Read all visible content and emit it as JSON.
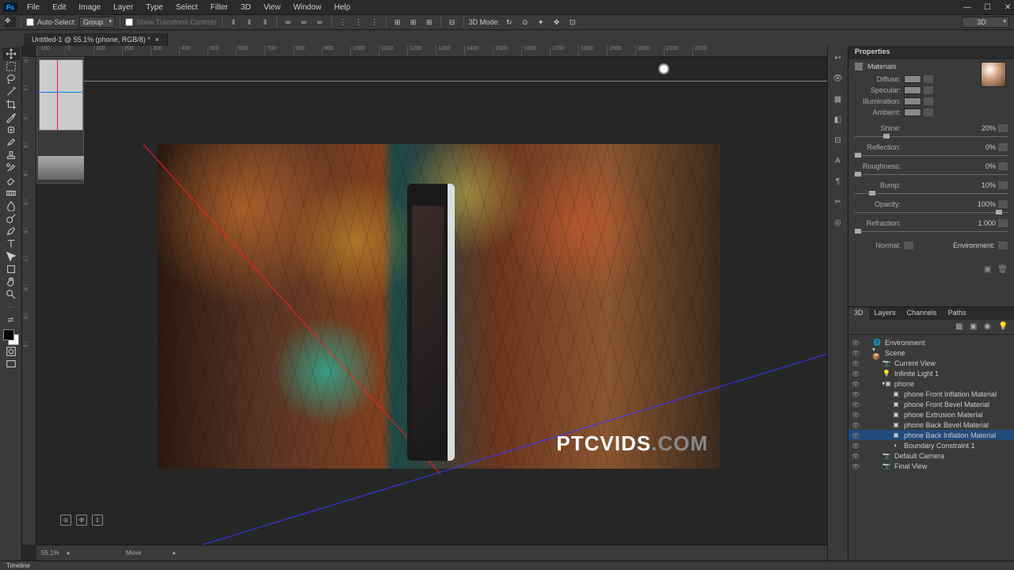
{
  "menu": {
    "items": [
      "File",
      "Edit",
      "Image",
      "Layer",
      "Type",
      "Select",
      "Filter",
      "3D",
      "View",
      "Window",
      "Help"
    ],
    "logo": "Ps"
  },
  "options": {
    "auto_select_label": "Auto-Select:",
    "group": "Group",
    "show_transform": "Show Transform Controls",
    "mode_label": "3D Mode:"
  },
  "tab": {
    "title": "Untitled-1 @ 55.1% (phone, RGB/8) *"
  },
  "ruler_marks": [
    "-100",
    "0",
    "100",
    "200",
    "300",
    "400",
    "500",
    "600",
    "700",
    "800",
    "900",
    "1000",
    "1100",
    "1200",
    "1300",
    "1400",
    "1500",
    "1600",
    "1700",
    "1800",
    "1900",
    "2000",
    "2100",
    "2200"
  ],
  "vruler_marks": [
    "0",
    "1",
    "2",
    "3",
    "4",
    "5",
    "6",
    "7",
    "8",
    "9",
    "1"
  ],
  "footer": {
    "zoom": "55.1%",
    "tool": "Move"
  },
  "timeline": {
    "label": "Timeline"
  },
  "watermark": {
    "a": "PTCVIDS",
    "b": ".COM"
  },
  "properties": {
    "title": "Properties",
    "subtitle": "Materials",
    "rows": [
      {
        "label": "Diffuse:",
        "swatch": true
      },
      {
        "label": "Specular:",
        "swatch": true
      },
      {
        "label": "Illumination:",
        "swatch": true
      },
      {
        "label": "Ambient:",
        "swatch": true
      }
    ],
    "sliders": [
      {
        "label": "Shine:",
        "value": "20%",
        "pos": 20
      },
      {
        "label": "Reflection:",
        "value": "0%",
        "pos": 0
      },
      {
        "label": "Roughness:",
        "value": "0%",
        "pos": 0
      },
      {
        "label": "Bump:",
        "value": "10%",
        "pos": 10
      },
      {
        "label": "Opacity:",
        "value": "100%",
        "pos": 100
      },
      {
        "label": "Refraction:",
        "value": "1.000",
        "pos": 0
      }
    ],
    "normal": "Normal:",
    "env": "Environment:"
  },
  "scene": {
    "tabs": [
      "3D",
      "Layers",
      "Channels",
      "Paths"
    ],
    "tree": [
      {
        "indent": 0,
        "icon": "🌐",
        "label": "Environment"
      },
      {
        "indent": 0,
        "icon": "▾📦",
        "label": "Scene"
      },
      {
        "indent": 1,
        "icon": "📷",
        "label": "Current View"
      },
      {
        "indent": 1,
        "icon": "💡",
        "label": "Infinite Light 1"
      },
      {
        "indent": 1,
        "icon": "▾▣",
        "label": "phone"
      },
      {
        "indent": 2,
        "icon": "▣",
        "label": "phone Front Inflation Material"
      },
      {
        "indent": 2,
        "icon": "▣",
        "label": "phone Front Bevel Material"
      },
      {
        "indent": 2,
        "icon": "▣",
        "label": "phone Extrusion Material"
      },
      {
        "indent": 2,
        "icon": "▣",
        "label": "phone Back Bevel Material"
      },
      {
        "indent": 2,
        "icon": "▣",
        "label": "phone Back Inflation Material",
        "selected": true
      },
      {
        "indent": 2,
        "icon": "◐",
        "label": "Boundary Constraint 1"
      },
      {
        "indent": 1,
        "icon": "📷",
        "label": "Default Camera"
      },
      {
        "indent": 1,
        "icon": "📷",
        "label": "Final View"
      }
    ]
  }
}
